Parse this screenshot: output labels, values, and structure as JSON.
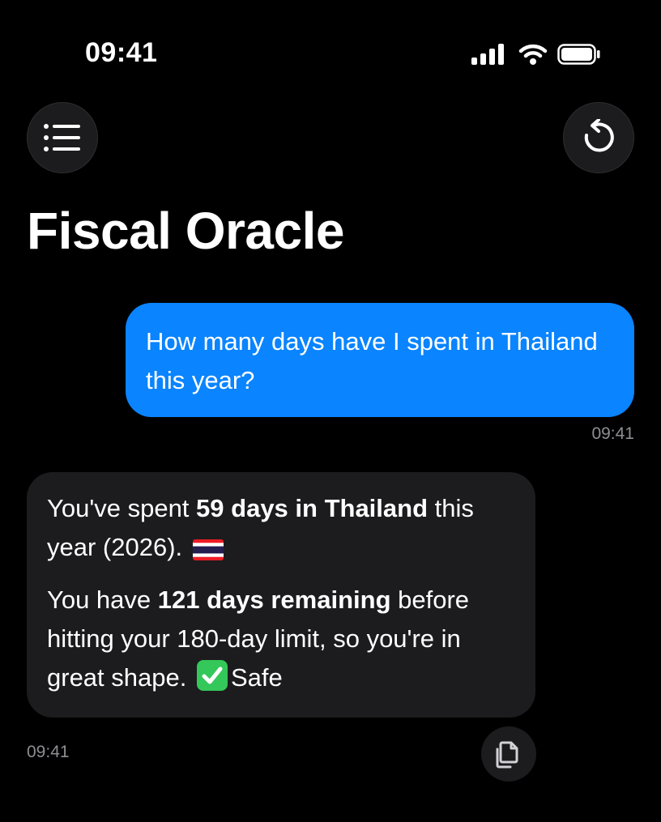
{
  "status_bar": {
    "time": "09:41",
    "icons": [
      "cellular-signal-icon",
      "wifi-icon",
      "battery-icon"
    ]
  },
  "header": {
    "menu_icon": "list-icon",
    "refresh_icon": "undo-refresh-icon",
    "title": "Fiscal Oracle"
  },
  "conversation": {
    "user_message": {
      "text": "How many days have I spent in Thailand this year?",
      "time": "09:41"
    },
    "assistant_message": {
      "p1_pre": "You've spent ",
      "p1_bold": "59 days in Thailand",
      "p1_post": " this year (2026).",
      "p1_icon": "thailand-flag-emoji",
      "p2_pre": "You have ",
      "p2_bold": "121 days remaining",
      "p2_post": " before hitting your 180-day limit, so you're in great shape.",
      "p2_icon": "check-mark-emoji",
      "p2_tail": "Safe",
      "time": "09:41",
      "copy_icon": "copy-icon"
    }
  },
  "colors": {
    "background": "#000000",
    "user_bubble": "#0a84ff",
    "assistant_bubble": "#1c1c1e",
    "timestamp": "#8e8e93",
    "check_green": "#34c759"
  }
}
